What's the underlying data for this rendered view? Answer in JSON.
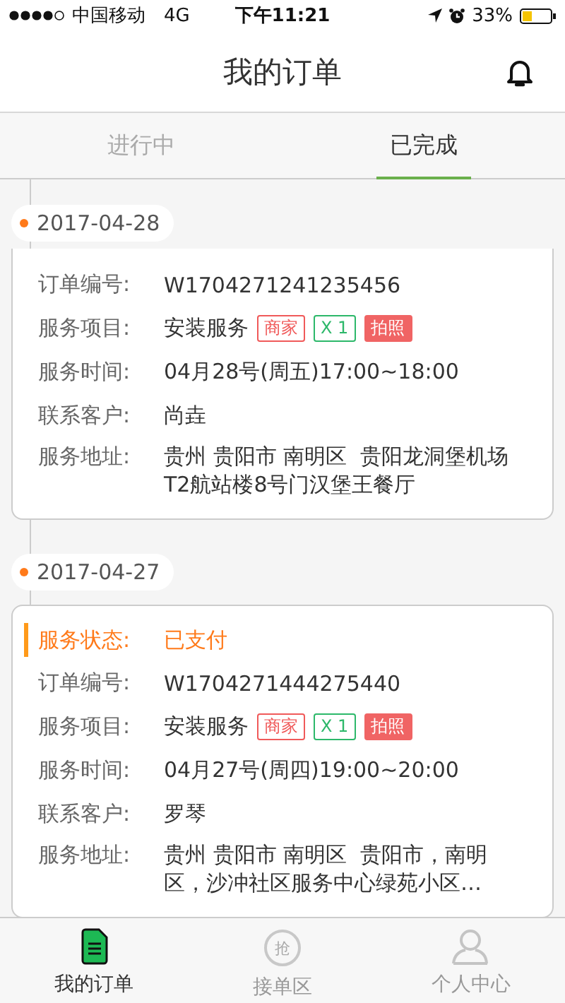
{
  "status_bar": {
    "carrier": "中国移动",
    "network": "4G",
    "time": "下午11:21",
    "battery_text": "33%"
  },
  "header": {
    "title": "我的订单"
  },
  "tabs": [
    {
      "label": "进行中",
      "selected": false
    },
    {
      "label": "已完成",
      "selected": true
    }
  ],
  "orders": [
    {
      "date": "2017-04-28",
      "rows": [
        {
          "label": "订单编号:",
          "value": "W1704271241235456"
        },
        {
          "label": "服务项目:",
          "value": "安装服务",
          "tags": [
            {
              "text": "商家",
              "kind": "outline",
              "color": "#f05a5a"
            },
            {
              "text": "X 1",
              "kind": "outline",
              "color": "#2db86a"
            },
            {
              "text": "拍照",
              "kind": "filled",
              "color": "#f06464"
            }
          ]
        },
        {
          "label": "服务时间:",
          "value": "04月28号(周五)17:00~18:00"
        },
        {
          "label": "联系客户:",
          "value": "尚垚"
        },
        {
          "label": "服务地址:",
          "value": "贵州 贵阳市 南明区  贵阳龙洞堡机场T2航站楼8号门汉堡王餐厅"
        }
      ]
    },
    {
      "date": "2017-04-27",
      "status": {
        "label": "服务状态:",
        "value": "已支付"
      },
      "rows": [
        {
          "label": "订单编号:",
          "value": "W1704271444275440"
        },
        {
          "label": "服务项目:",
          "value": "安装服务",
          "tags": [
            {
              "text": "商家",
              "kind": "outline",
              "color": "#f05a5a"
            },
            {
              "text": "X 1",
              "kind": "outline",
              "color": "#2db86a"
            },
            {
              "text": "拍照",
              "kind": "filled",
              "color": "#f06464"
            }
          ]
        },
        {
          "label": "服务时间:",
          "value": "04月27号(周四)19:00~20:00"
        },
        {
          "label": "联系客户:",
          "value": "罗琴"
        },
        {
          "label": "服务地址:",
          "value": "贵州 贵阳市 南明区  贵阳市，南明区，沙冲社区服务中心绿苑小区…"
        }
      ]
    }
  ],
  "tab_bar": [
    {
      "label": "我的订单",
      "kind": "document",
      "selected": true
    },
    {
      "label": "接单区",
      "kind": "grab",
      "icon_text": "抢",
      "selected": false
    },
    {
      "label": "个人中心",
      "kind": "person",
      "selected": false
    }
  ]
}
